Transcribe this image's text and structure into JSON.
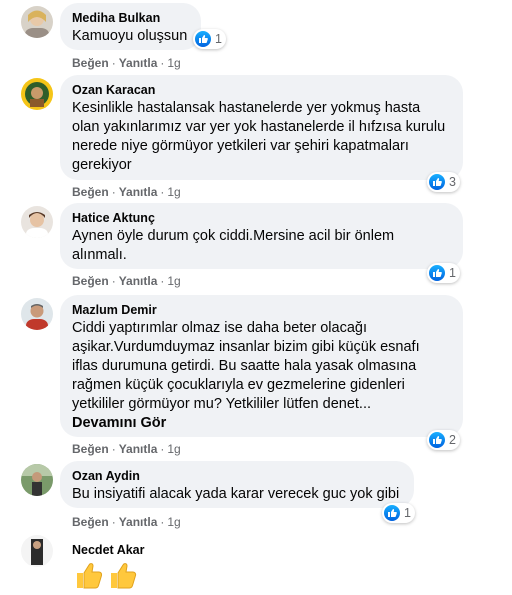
{
  "comments": [
    {
      "author": "Mediha Bulkan",
      "lines": [
        "Kamuoyu oluşsun"
      ],
      "actions": {
        "like": "Beğen",
        "reply": "Yanıtla",
        "time": "1g"
      },
      "reactions": "1"
    },
    {
      "author": "Ozan Karacan",
      "lines": [
        "Kesinlikle hastalansak hastanelerde yer yokmuş hasta",
        "olan yakınlarımız var yer yok hastanelerde il hıfzısa kurulu",
        "nerede niye görmüyor yetkileri var şehiri kapatmaları",
        "gerekiyor"
      ],
      "actions": {
        "like": "Beğen",
        "reply": "Yanıtla",
        "time": "1g"
      },
      "reactions": "3"
    },
    {
      "author": "Hatice Aktunç",
      "lines": [
        "Aynen öyle durum çok ciddi.Mersine acil bir önlem",
        "alınmalı."
      ],
      "actions": {
        "like": "Beğen",
        "reply": "Yanıtla",
        "time": "1g"
      },
      "reactions": "1"
    },
    {
      "author": "Mazlum Demir",
      "lines": [
        "Ciddi yaptırımlar olmaz ise daha beter olacağı",
        "aşikar.Vurdumduymaz insanlar bizim gibi küçük esnafı",
        "iflas durumuna getirdi. Bu saatte hala yasak olmasına",
        "rağmen küçük çocuklarıyla ev gezmelerine gidenleri",
        "yetkililer görmüyor mu? Yetkililer lütfen denet..."
      ],
      "see_more": "Devamını Gör",
      "actions": {
        "like": "Beğen",
        "reply": "Yanıtla",
        "time": "1g"
      },
      "reactions": "2"
    },
    {
      "author": "Ozan Aydin",
      "lines": [
        "Bu insiyatifi alacak yada karar verecek guc yok gibi"
      ],
      "actions": {
        "like": "Beğen",
        "reply": "Yanıtla",
        "time": "1g"
      },
      "reactions": "1"
    },
    {
      "author": "Necdet Akar",
      "emojis": [
        "thumbs-up",
        "thumbs-up"
      ]
    }
  ],
  "colors": {
    "bubble": "#f0f2f5",
    "like_blue": "#1877f2",
    "meta_gray": "#65676b",
    "emoji_yellow": "#ffc83d"
  }
}
